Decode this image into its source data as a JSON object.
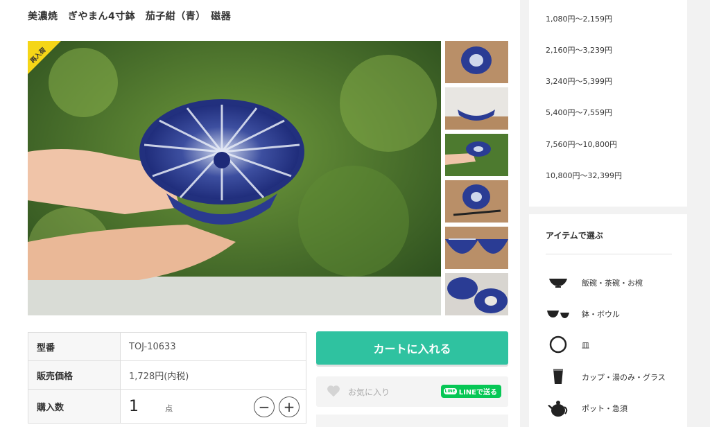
{
  "product": {
    "title": "美濃焼　ぎやまん4寸鉢　茄子紺（青）　磁器",
    "badge": "再入荷",
    "thumbnails": [
      "thumb-1",
      "thumb-2",
      "thumb-3",
      "thumb-4",
      "thumb-5",
      "thumb-6"
    ]
  },
  "info_table": {
    "rows": [
      {
        "label": "型番",
        "value": "TOJ-10633"
      },
      {
        "label": "販売価格",
        "value": "1,728円(内税)"
      },
      {
        "label": "購入数",
        "value": "1"
      }
    ],
    "qty_unit": "点",
    "minus": "−",
    "plus": "+"
  },
  "actions": {
    "cart_label": "カートに入れる",
    "favorite_label": "お気に入り",
    "line_label": "LINEで送る",
    "line_icon": "LINE"
  },
  "price_ranges": [
    "1,080円〜2,159円",
    "2,160円〜3,239円",
    "3,240円〜5,399円",
    "5,400円〜7,559円",
    "7,560円〜10,800円",
    "10,800円〜32,399円"
  ],
  "item_categories": {
    "title": "アイテムで選ぶ",
    "items": [
      {
        "label": "飯碗・茶碗・お椀",
        "icon": "rice-bowl-icon"
      },
      {
        "label": "鉢・ボウル",
        "icon": "bowls-icon"
      },
      {
        "label": "皿",
        "icon": "plate-icon"
      },
      {
        "label": "カップ・湯のみ・グラス",
        "icon": "cup-icon"
      },
      {
        "label": "ポット・急須",
        "icon": "teapot-icon"
      }
    ]
  },
  "colors": {
    "accent": "#2fc2a0",
    "badge": "#f5d617",
    "line": "#06c755"
  }
}
